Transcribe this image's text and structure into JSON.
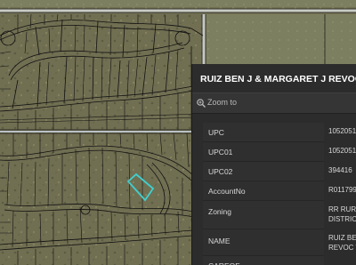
{
  "popup": {
    "title": "RUIZ BEN J & MARGARET J REVOC T",
    "zoom_label": "Zoom to",
    "attributes": [
      {
        "key": "UPC",
        "value_lines": [
          "1052051"
        ]
      },
      {
        "key": "UPC01",
        "value_lines": [
          "1052051"
        ]
      },
      {
        "key": "UPC02",
        "value_lines": [
          "394416"
        ]
      },
      {
        "key": "AccountNo",
        "value_lines": [
          "R011799"
        ]
      },
      {
        "key": "Zoning",
        "value_lines": [
          "RR RURA",
          "DISTRICT"
        ]
      },
      {
        "key": "NAME",
        "value_lines": [
          "RUIZ BEN",
          "REVOC T"
        ]
      },
      {
        "key": "CAREOF",
        "value_lines": [
          ""
        ]
      }
    ]
  },
  "map": {
    "selected_parcel_color": "#40d0d0",
    "parcel_line_color": "#111111",
    "road_color": "#bfc7c0"
  }
}
